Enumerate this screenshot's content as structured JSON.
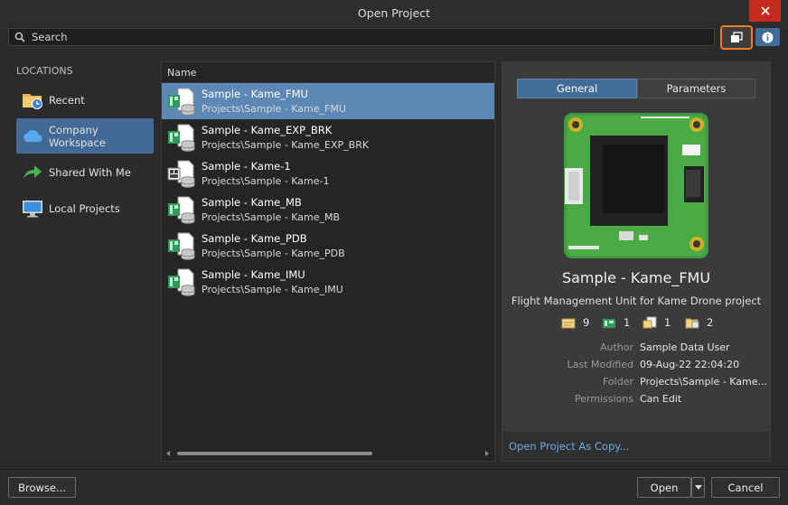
{
  "window": {
    "title": "Open Project"
  },
  "search": {
    "placeholder": "Search"
  },
  "locations": {
    "header": "LOCATIONS",
    "items": [
      {
        "label": "Recent",
        "icon": "recent-folder-icon"
      },
      {
        "label": "Company Workspace",
        "icon": "cloud-icon",
        "selected": true
      },
      {
        "label": "Shared With Me",
        "icon": "share-arrow-icon"
      },
      {
        "label": "Local Projects",
        "icon": "monitor-icon"
      }
    ]
  },
  "list": {
    "column_header": "Name",
    "rows": [
      {
        "name": "Sample - Kame_FMU",
        "path": "Projects\\Sample - Kame_FMU",
        "selected": true,
        "icon": "pcb-project-icon"
      },
      {
        "name": "Sample - Kame_EXP_BRK",
        "path": "Projects\\Sample - Kame_EXP_BRK",
        "icon": "pcb-project-icon"
      },
      {
        "name": "Sample - Kame-1",
        "path": "Projects\\Sample - Kame-1",
        "icon": "multiboard-project-icon"
      },
      {
        "name": "Sample - Kame_MB",
        "path": "Projects\\Sample - Kame_MB",
        "icon": "pcb-project-icon"
      },
      {
        "name": "Sample - Kame_PDB",
        "path": "Projects\\Sample - Kame_PDB",
        "icon": "pcb-project-icon"
      },
      {
        "name": "Sample - Kame_IMU",
        "path": "Projects\\Sample - Kame_IMU",
        "icon": "pcb-project-icon"
      }
    ]
  },
  "details": {
    "tabs": [
      {
        "label": "General",
        "active": true
      },
      {
        "label": "Parameters"
      }
    ],
    "title": "Sample - Kame_FMU",
    "description": "Flight Management Unit for Kame Drone project",
    "counts": [
      {
        "icon": "schematic-doc-icon",
        "value": "9"
      },
      {
        "icon": "pcb-doc-icon",
        "value": "1"
      },
      {
        "icon": "outjob-doc-icon",
        "value": "1"
      },
      {
        "icon": "other-doc-icon",
        "value": "2"
      }
    ],
    "properties": [
      {
        "label": "Author",
        "value": "Sample Data User"
      },
      {
        "label": "Last Modified",
        "value": "09-Aug-22 22:04:20"
      },
      {
        "label": "Folder",
        "value": "Projects\\Sample - Kame..."
      },
      {
        "label": "Permissions",
        "value": "Can Edit"
      }
    ],
    "copy_link": "Open Project As Copy..."
  },
  "buttons": {
    "browse": "Browse...",
    "open": "Open",
    "cancel": "Cancel"
  },
  "colors": {
    "accent": "#426c98",
    "selection": "#5d87b4",
    "highlight": "#ef7b22",
    "close": "#c42b1c"
  }
}
